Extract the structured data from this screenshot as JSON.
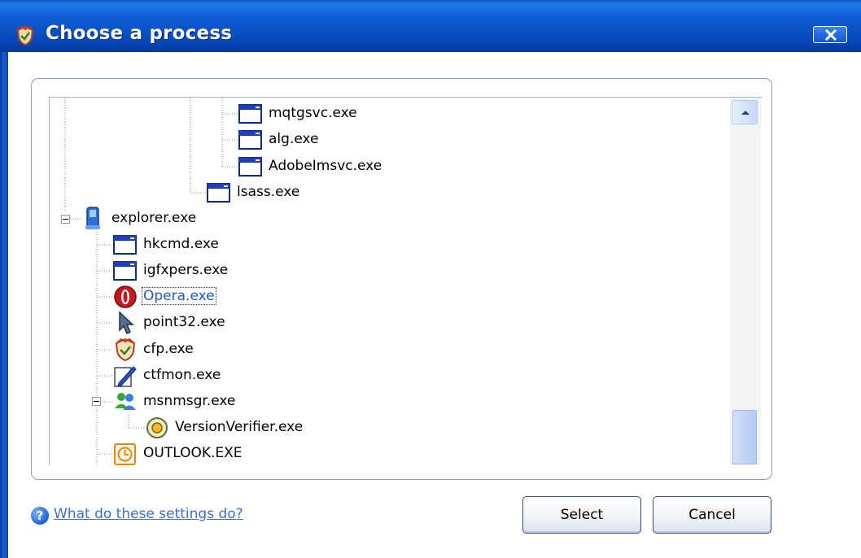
{
  "window": {
    "title": "Choose a process",
    "close_label": "X"
  },
  "tree": {
    "nodes": [
      {
        "label": "mqtgsvc.exe",
        "icon": "app-window-icon"
      },
      {
        "label": "alg.exe",
        "icon": "app-window-icon"
      },
      {
        "label": "AdobeImsvc.exe",
        "icon": "app-window-icon"
      },
      {
        "label": "lsass.exe",
        "icon": "app-window-icon"
      },
      {
        "label": "explorer.exe",
        "icon": "explorer-icon",
        "expanded": true
      },
      {
        "label": "hkcmd.exe",
        "icon": "app-window-icon"
      },
      {
        "label": "igfxpers.exe",
        "icon": "app-window-icon"
      },
      {
        "label": "Opera.exe",
        "icon": "opera-icon",
        "selected": true
      },
      {
        "label": "point32.exe",
        "icon": "mouse-pointer-icon"
      },
      {
        "label": "cfp.exe",
        "icon": "comodo-shield-icon"
      },
      {
        "label": "ctfmon.exe",
        "icon": "pen-icon"
      },
      {
        "label": "msnmsgr.exe",
        "icon": "msn-messenger-icon",
        "expanded": true
      },
      {
        "label": "VersionVerifier.exe",
        "icon": "version-verifier-icon"
      },
      {
        "label": "OUTLOOK.EXE",
        "icon": "outlook-clock-icon"
      }
    ]
  },
  "footer": {
    "help_icon_glyph": "?",
    "help_link": "What do these settings do?",
    "select_label": "Select",
    "cancel_label": "Cancel"
  },
  "colors": {
    "titlebar": "#0a4ec4",
    "link": "#3b6fd1",
    "selected_text": "#1f58c4"
  }
}
